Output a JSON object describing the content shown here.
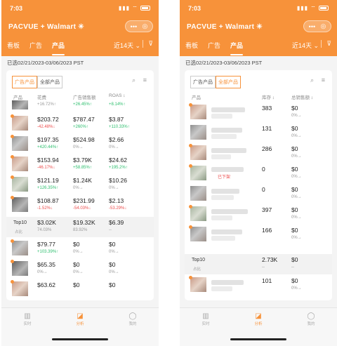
{
  "brand": {
    "accent": "#f7923a",
    "up": "#2dbf6e",
    "down": "#ec4c4c"
  },
  "status": {
    "time": "7:03",
    "icons": "▮▮▮ ⌔"
  },
  "logo": {
    "text": "PACVUE + Walmart ✳",
    "icon": "pacvue-logo"
  },
  "capsule": {
    "more": "•••",
    "target": "◎"
  },
  "tabs": [
    {
      "label": "看板"
    },
    {
      "label": "广告"
    },
    {
      "label": "产品"
    }
  ],
  "period": "近14天 ⌄",
  "filter_icon": "⊽",
  "date_range": "已选02/21/2023-03/06/2023 PST",
  "toggle": {
    "ad_products": "广告产品",
    "all_products": "全部产品"
  },
  "tools": {
    "search": "⌕",
    "sort": "≡"
  },
  "left": {
    "columns": {
      "product": "产品",
      "spend": "花费",
      "ad_sales": "广告销售额",
      "roas": "ROAS ↕"
    },
    "partial_row": {
      "spend_chg": "+16.72%↑",
      "sales_chg": "+26.45%↑",
      "roas_chg": "+8.14%↑"
    },
    "rows": [
      {
        "spend": "$203.72",
        "spend_chg": "-42.48%↓",
        "sales": "$787.47",
        "sales_chg": "+260%↑",
        "roas": "$3.87",
        "roas_chg": "+110.33%↑"
      },
      {
        "spend": "$197.35",
        "spend_chg": "+420.44%↑",
        "sales": "$524.98",
        "sales_chg": "0%→",
        "roas": "$2.66",
        "roas_chg": "0%→"
      },
      {
        "spend": "$153.94",
        "spend_chg": "-46.17%↓",
        "sales": "$3.79K",
        "sales_chg": "+58.85%↑",
        "roas": "$24.62",
        "roas_chg": "+195.2%↑"
      },
      {
        "spend": "$121.19",
        "spend_chg": "+126.35%↑",
        "sales": "$1.24K",
        "sales_chg": "0%→",
        "roas": "$10.26",
        "roas_chg": "0%→"
      },
      {
        "spend": "$108.87",
        "spend_chg": "-1.52%↓",
        "sales": "$231.99",
        "sales_chg": "-54.03%↓",
        "roas": "$2.13",
        "roas_chg": "-53.29%↓"
      }
    ],
    "top10": {
      "label": "Top10",
      "sub": "占比",
      "spend": "$3.02K",
      "spend_pct": "74.03%",
      "sales": "$19.32K",
      "sales_pct": "83.92%",
      "roas": "$6.39",
      "roas_pct": "--"
    },
    "rows_after": [
      {
        "spend": "$79.77",
        "spend_chg": "+103.39%↑",
        "sales": "$0",
        "sales_chg": "0%→",
        "roas": "$0",
        "roas_chg": "0%→"
      },
      {
        "spend": "$65.35",
        "spend_chg": "0%→",
        "sales": "$0",
        "sales_chg": "0%→",
        "roas": "$0",
        "roas_chg": "0%→"
      },
      {
        "spend": "$63.62",
        "spend_chg": "",
        "sales": "$0",
        "sales_chg": "",
        "roas": "$0",
        "roas_chg": ""
      }
    ]
  },
  "right": {
    "columns": {
      "product": "产品",
      "inventory": "库存 ↕",
      "total_sales": "总销售额 ↕"
    },
    "rows": [
      {
        "inventory": "383",
        "sales": "$0",
        "sales_chg": "0%→"
      },
      {
        "inventory": "131",
        "sales": "$0",
        "sales_chg": "0%→"
      },
      {
        "inventory": "286",
        "sales": "$0",
        "sales_chg": "0%→"
      },
      {
        "inventory": "0",
        "sales": "$0",
        "sales_chg": "0%→",
        "tag": "已下架"
      },
      {
        "inventory": "0",
        "sales": "$0",
        "sales_chg": "0%→"
      },
      {
        "inventory": "397",
        "sales": "$0",
        "sales_chg": "0%→"
      },
      {
        "inventory": "166",
        "sales": "$0",
        "sales_chg": "0%→"
      }
    ],
    "top10": {
      "label": "Top10",
      "sub": "占比",
      "inventory": "2.73K",
      "inventory_pct": "--",
      "sales": "$0",
      "sales_pct": "--"
    },
    "rows_after": [
      {
        "inventory": "101",
        "sales": "$0",
        "sales_chg": "0%→"
      }
    ]
  },
  "bottom_nav": [
    {
      "label": "实时",
      "icon": "bar-chart-icon",
      "glyph": "▥"
    },
    {
      "label": "分析",
      "icon": "trend-chart-icon",
      "glyph": "◪"
    },
    {
      "label": "我的",
      "icon": "user-icon",
      "glyph": "◯"
    }
  ]
}
